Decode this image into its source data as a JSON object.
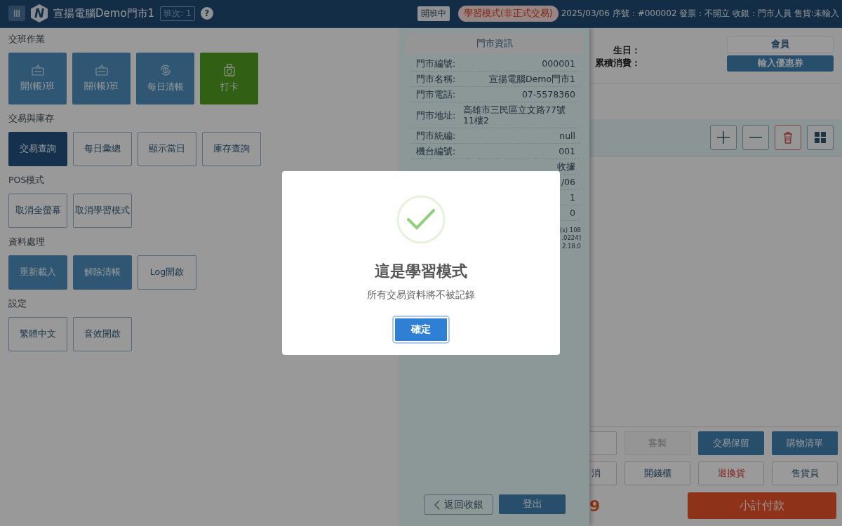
{
  "header": {
    "logo_letter": "N",
    "store_name": "宣揚電腦Demo門市1",
    "shift_badge": "班次: 1",
    "help": "?",
    "status": "開班中",
    "mode_badge": "學習模式(非正式交易)",
    "info": "2025/03/06 序號：#000002 發票：不開立 收銀：門市人員 售貨:未輸入"
  },
  "menu_sections": [
    {
      "title": "交班作業",
      "buttons": [
        {
          "label": "開(帳)班",
          "kind": "tile"
        },
        {
          "label": "關(帳)班",
          "kind": "tile"
        },
        {
          "label": "每日清帳",
          "kind": "tile"
        },
        {
          "label": "打卡",
          "kind": "tile-green"
        }
      ]
    },
    {
      "title": "交易與庫存",
      "buttons": [
        {
          "label": "交易查詢",
          "kind": "active"
        },
        {
          "label": "每日彙總",
          "kind": "outline"
        },
        {
          "label": "顯示當日",
          "kind": "outline"
        },
        {
          "label": "庫存查詢",
          "kind": "outline"
        }
      ]
    },
    {
      "title": "POS模式",
      "buttons": [
        {
          "label": "取消全螢幕",
          "kind": "outline"
        },
        {
          "label": "取消學習模式",
          "kind": "outline"
        }
      ]
    },
    {
      "title": "資料處理",
      "buttons": [
        {
          "label": "重新載入",
          "kind": "primary"
        },
        {
          "label": "解除清帳",
          "kind": "primary"
        },
        {
          "label": "Log開啟",
          "kind": "outline"
        }
      ]
    },
    {
      "title": "設定",
      "buttons": [
        {
          "label": "繁體中文",
          "kind": "outline"
        },
        {
          "label": "音效開啟",
          "kind": "outline"
        }
      ]
    }
  ],
  "store_panel": {
    "title": "門市資訊",
    "rows": [
      {
        "label": "門市編號:",
        "value": "000001"
      },
      {
        "label": "門市名稱:",
        "value": "宣揚電腦Demo門市1"
      },
      {
        "label": "門市電話:",
        "value": "07-5578360"
      },
      {
        "label": "門市地址:",
        "value": "高雄市三民區立文路77號11樓2"
      },
      {
        "label": "門市統編:",
        "value": "null"
      },
      {
        "label": "機台編號:",
        "value": "001"
      },
      {
        "value": "收據"
      },
      {
        "value": "/06"
      },
      {
        "value": "1"
      },
      {
        "value": "0"
      }
    ],
    "version_lines": [
      "(s) 108",
      ".0224]",
      "2.18.0"
    ],
    "back_button": "返回收銀",
    "logout_button": "登出"
  },
  "member": {
    "birthday_label": "生日：",
    "spending_label": "累積消費：",
    "member_button": "會員",
    "coupon_button": "輸入優惠券"
  },
  "action_rows": [
    [
      {
        "kind": "outline"
      },
      {
        "label": "客製",
        "kind": "disabled"
      },
      {
        "label": "交易保留",
        "kind": "primary"
      },
      {
        "label": "購物清單",
        "kind": "primary"
      }
    ],
    [
      {
        "label": "消",
        "kind": "outline"
      },
      {
        "label": "開錢櫃",
        "kind": "outline"
      },
      {
        "label": "退換貨",
        "kind": "danger"
      },
      {
        "label": "售貨員",
        "kind": "outline"
      }
    ]
  ],
  "total": "9",
  "pay_button": "小計付款",
  "modal": {
    "title": "這是學習模式",
    "message": "所有交易資料將不被記錄",
    "confirm": "確定"
  }
}
